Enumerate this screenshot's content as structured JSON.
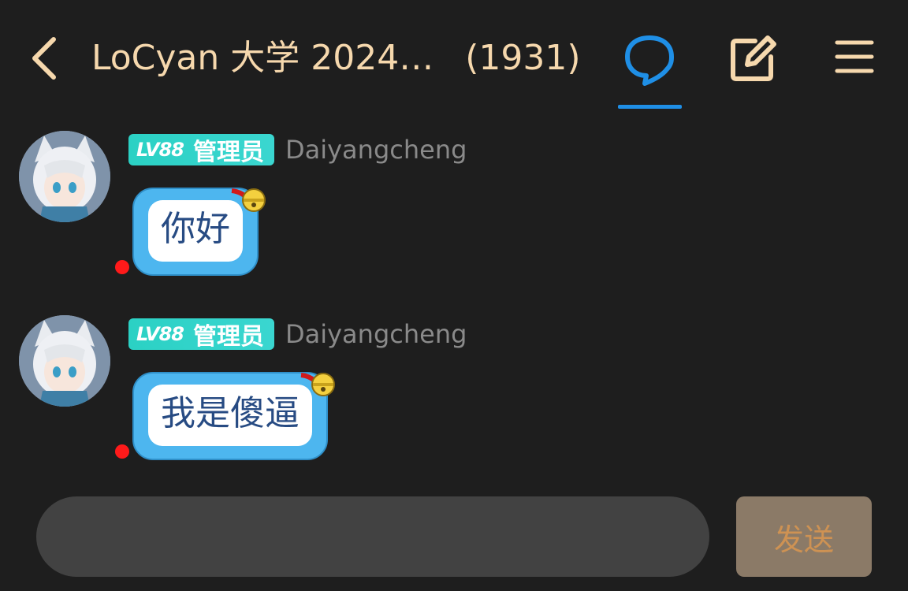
{
  "header": {
    "title": "LoCyan 大学 2024…",
    "member_count": "(1931)",
    "icons": {
      "back": "chevron-left-icon",
      "chat": "chat-bubble-icon",
      "edit": "edit-square-icon",
      "menu": "hamburger-menu-icon"
    },
    "title_color": "#f6d8ad",
    "active_tab_color": "#1f8fe6"
  },
  "messages": [
    {
      "level": "LV88",
      "role": "管理员",
      "username": "Daiyangcheng",
      "text": "你好"
    },
    {
      "level": "LV88",
      "role": "管理员",
      "username": "Daiyangcheng",
      "text": "我是傻逼"
    }
  ],
  "composer": {
    "placeholder": "",
    "value": "",
    "send_label": "发送"
  },
  "colors": {
    "background": "#1e1e1e",
    "badge": "#2bd1c4",
    "bubble": "#4db6ef",
    "bubble_text": "#274b83",
    "unread_dot": "#ff1a1a",
    "send_button": "#8b7a67"
  }
}
